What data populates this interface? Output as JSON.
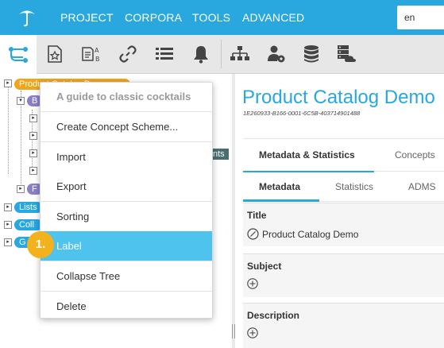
{
  "nav": {
    "items": [
      "PROJECT",
      "CORPORA",
      "TOOLS",
      "ADVANCED"
    ],
    "language": "en"
  },
  "toolbar": {
    "icons": [
      "hierarchy-icon",
      "concept-scheme-icon",
      "abc-label-icon",
      "link-icon",
      "list-icon",
      "bell-icon",
      "org-chart-icon",
      "user-settings-icon",
      "database-icon",
      "server-cloud-icon"
    ]
  },
  "tree": {
    "items": [
      {
        "label": "Product Catalog Demo",
        "kind": "project"
      },
      {
        "label": "B",
        "kind": "scheme"
      },
      {
        "label": "nts",
        "kind": "concept-selected"
      },
      {
        "label": "F",
        "kind": "scheme"
      },
      {
        "label": "Lists",
        "kind": "root"
      },
      {
        "label": "Coll",
        "kind": "root"
      },
      {
        "label": "G",
        "kind": "root"
      }
    ]
  },
  "context_menu": {
    "title": "A guide to classic cocktails",
    "items": [
      "Create Concept Scheme...",
      "Import",
      "Export",
      "Sorting",
      "Label",
      "Collapse Tree",
      "Delete"
    ],
    "highlighted": "Label",
    "step_badge": "1."
  },
  "detail": {
    "title": "Product Catalog Demo",
    "uuid": "1E260933-B166-0001-6C5B-403714901488",
    "tabs": [
      "Metadata & Statistics",
      "Concepts"
    ],
    "subtabs": [
      "Metadata",
      "Statistics",
      "ADMS"
    ],
    "fields": {
      "title_label": "Title",
      "title_value": "Product Catalog Demo",
      "subject_label": "Subject",
      "description_label": "Description"
    }
  },
  "colors": {
    "brand": "#29a8e0",
    "highlight": "#4dc3ee",
    "project_pill": "#f2a51a",
    "scheme_pill": "#8c7fc4",
    "badge": "#f2b21e"
  }
}
